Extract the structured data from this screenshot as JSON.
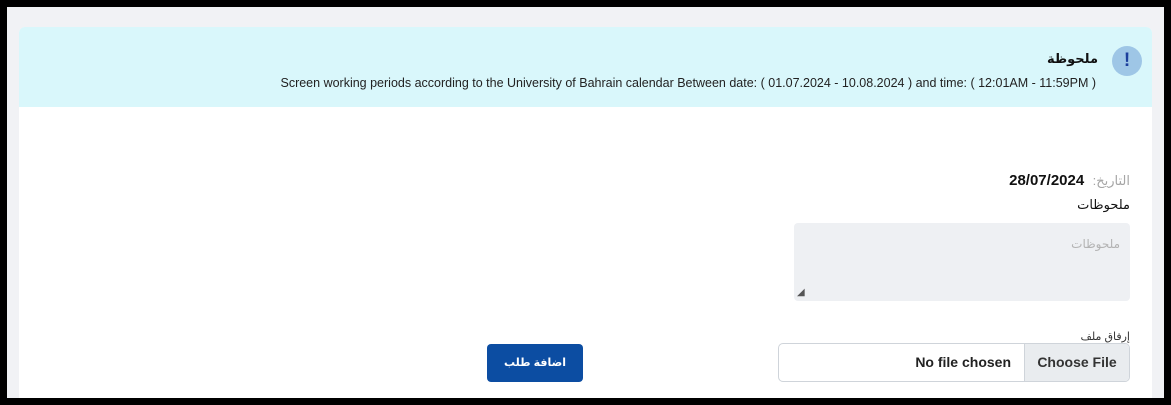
{
  "alert": {
    "icon": "exclamation-icon",
    "icon_glyph": "!",
    "title": "ملحوظة",
    "message": "Screen working periods according to the University of Bahrain calendar Between date: ( 01.07.2024 - 10.08.2024 ) and time: ( 12:01AM - 11:59PM )"
  },
  "form": {
    "date_label": "التاريخ:",
    "date_value": "28/07/2024",
    "notes_label": "ملحوظات",
    "notes_placeholder": "ملحوظات",
    "notes_value": "",
    "attach_label": "إرفاق ملف",
    "choose_file_label": "Choose File",
    "file_status": "No file chosen",
    "submit_label": "اضافة طلب"
  },
  "colors": {
    "alert_bg": "#d9f7fb",
    "primary_button": "#0c4da2",
    "info_icon_bg": "#9ec6e6"
  }
}
